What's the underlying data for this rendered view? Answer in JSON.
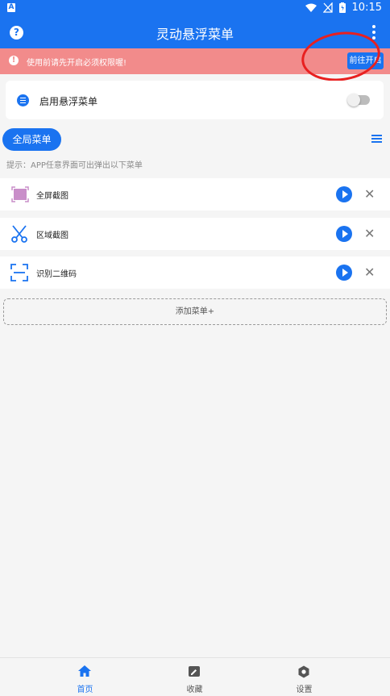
{
  "statusbar": {
    "time": "10:15"
  },
  "appbar": {
    "title": "灵动悬浮菜单"
  },
  "warning": {
    "text": "使用前请先开启必须权限喔!",
    "button": "前往开启"
  },
  "card": {
    "label": "启用悬浮菜单",
    "enabled": false
  },
  "section": {
    "button": "全局菜单",
    "hint": "提示：APP任意界面可出弹出以下菜单"
  },
  "menu_items": [
    {
      "label": "全屏截图",
      "icon": "fullscreen-screenshot-icon"
    },
    {
      "label": "区域截图",
      "icon": "scissors-icon"
    },
    {
      "label": "识别二维码",
      "icon": "qr-scan-icon"
    }
  ],
  "add_button": "添加菜单+",
  "tabs": [
    {
      "label": "首页",
      "icon": "home-icon",
      "active": true
    },
    {
      "label": "收藏",
      "icon": "edit-icon",
      "active": false
    },
    {
      "label": "设置",
      "icon": "settings-icon",
      "active": false
    }
  ],
  "colors": {
    "primary": "#1a73f0",
    "warning_bg": "#f28b8b",
    "annotation": "#e82020"
  }
}
